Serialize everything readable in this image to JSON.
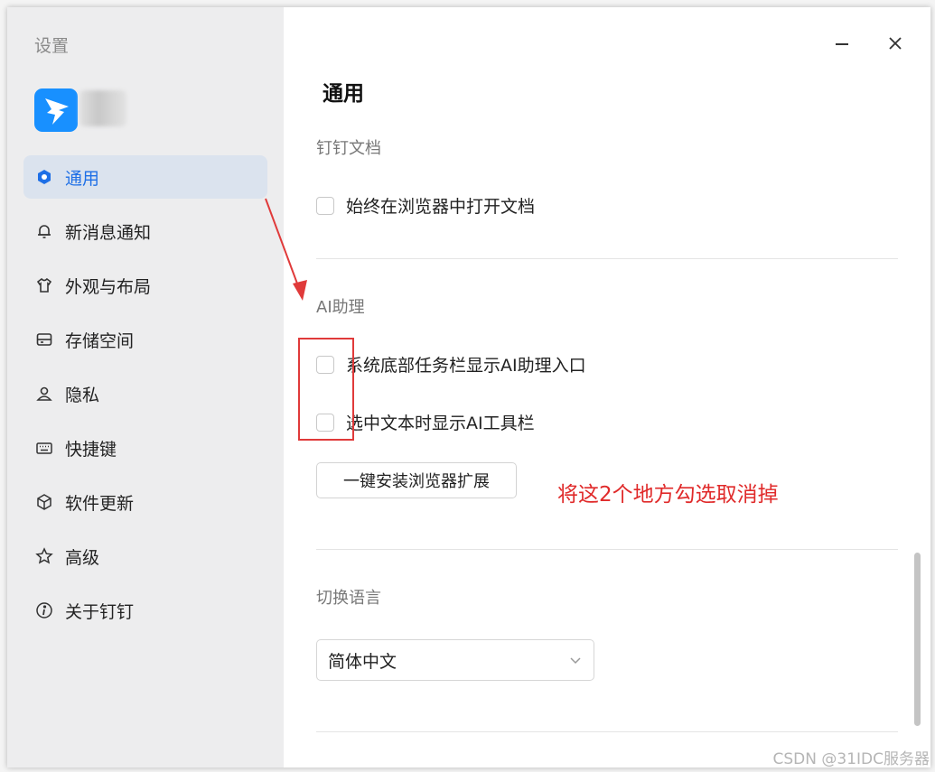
{
  "window": {
    "sidebar_title": "设置",
    "minimize_symbol": "—",
    "close_symbol": "✕"
  },
  "sidebar": {
    "items": [
      {
        "label": "通用",
        "icon": "gear-icon",
        "active": true
      },
      {
        "label": "新消息通知",
        "icon": "bell-icon"
      },
      {
        "label": "外观与布局",
        "icon": "shirt-icon"
      },
      {
        "label": "存储空间",
        "icon": "storage-icon"
      },
      {
        "label": "隐私",
        "icon": "user-icon"
      },
      {
        "label": "快捷键",
        "icon": "keyboard-icon"
      },
      {
        "label": "软件更新",
        "icon": "cube-icon"
      },
      {
        "label": "高级",
        "icon": "star-icon"
      },
      {
        "label": "关于钉钉",
        "icon": "info-icon"
      }
    ]
  },
  "main": {
    "title": "通用",
    "docs_section": {
      "label": "钉钉文档",
      "open_in_browser": {
        "label": "始终在浏览器中打开文档",
        "checked": false
      }
    },
    "ai_section": {
      "label": "AI助理",
      "taskbar_entry": {
        "label": "系统底部任务栏显示AI助理入口",
        "checked": false
      },
      "toolbar_on_select": {
        "label": "选中文本时显示AI工具栏",
        "checked": false
      },
      "install_button": "一键安装浏览器扩展"
    },
    "language_section": {
      "label": "切换语言",
      "selected": "简体中文"
    }
  },
  "annotation": {
    "text": "将这2个地方勾选取消掉",
    "color": "#e02a2a"
  },
  "watermark": "CSDN @31IDC服务器",
  "colors": {
    "accent": "#1e6fe6",
    "active_bg": "#dbe3ee",
    "logo": "#1890ff"
  }
}
